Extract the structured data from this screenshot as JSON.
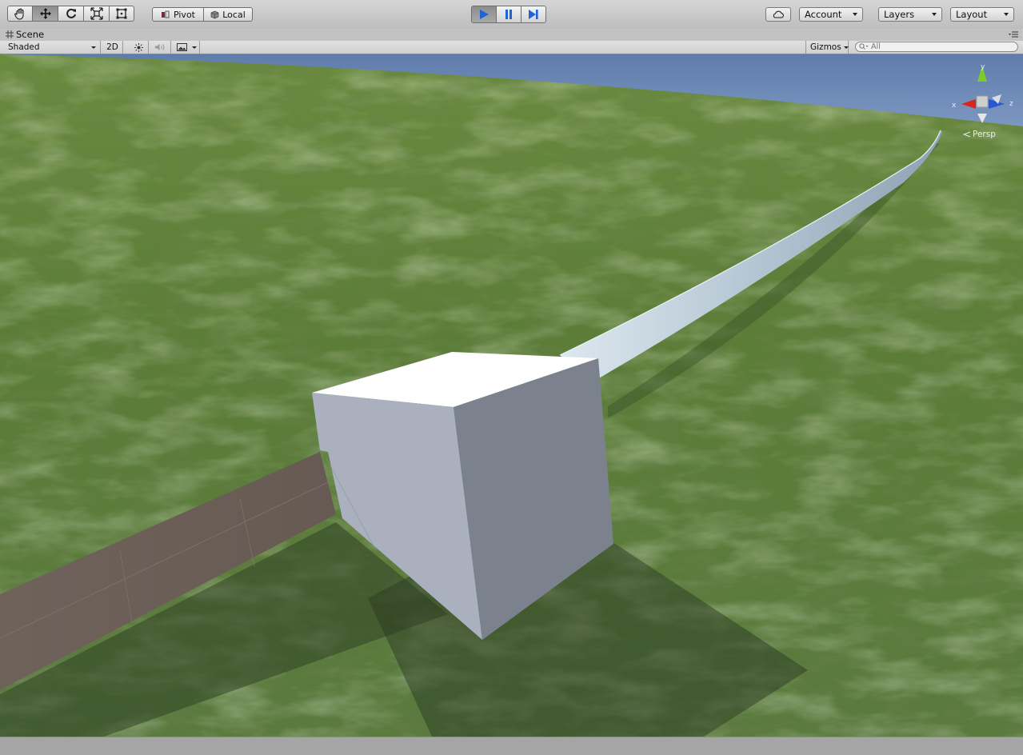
{
  "toolbar": {
    "tools": [
      "hand-tool",
      "move-tool",
      "rotate-tool",
      "scale-tool",
      "rect-tool"
    ],
    "active_tool": "move-tool",
    "pivot_label": "Pivot",
    "local_label": "Local",
    "play_controls": [
      "play",
      "pause",
      "step"
    ],
    "account_label": "Account",
    "layers_label": "Layers",
    "layout_label": "Layout"
  },
  "scene_tab": {
    "title": "Scene"
  },
  "scene_toolbar": {
    "draw_mode": "Shaded",
    "mode_2d_label": "2D",
    "gizmos_label": "Gizmos",
    "search_placeholder": "All"
  },
  "view_gizmo": {
    "x_label": "x",
    "y_label": "y",
    "z_label": "z",
    "projection_label": "Persp"
  },
  "colors": {
    "sky": "#6e8ab4",
    "grass": "#5f7f3a",
    "cube_top": "#ffffff",
    "cube_left": "#a9afbc",
    "cube_right": "#7c838f",
    "road": "#6b5f58",
    "play_blue": "#1f63d8",
    "axis_x": "#d8261b",
    "axis_y": "#7ccb2a",
    "axis_z": "#2a56d4"
  }
}
